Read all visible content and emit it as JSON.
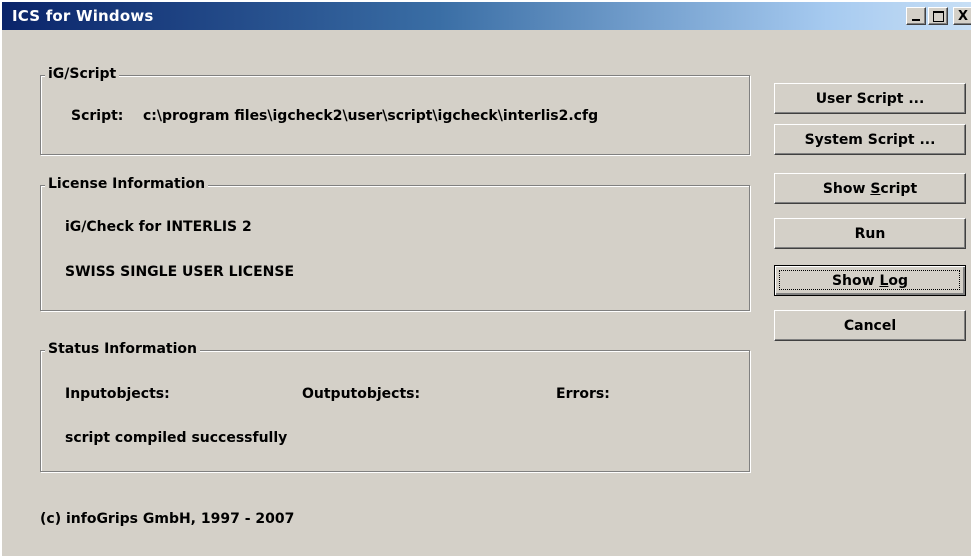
{
  "window": {
    "title": "ICS for Windows"
  },
  "caption_buttons": {
    "close_glyph": "X"
  },
  "script_group": {
    "label": "iG/Script",
    "script_label": "Script:",
    "script_path": "c:\\program files\\igcheck2\\user\\script\\igcheck\\interlis2.cfg"
  },
  "license_group": {
    "label": "License Information",
    "product": "iG/Check for INTERLIS 2",
    "license": "SWISS SINGLE USER LICENSE"
  },
  "status_group": {
    "label": "Status Information",
    "input_label": "Inputobjects:",
    "output_label": "Outputobjects:",
    "errors_label": "Errors:",
    "message": "script compiled successfully"
  },
  "footer": {
    "copyright": "(c) infoGrips GmbH, 1997 - 2007"
  },
  "buttons": {
    "user_script": "User Script ...",
    "system_script": "System Script ...",
    "show_script_prefix": "Show ",
    "show_script_accel": "S",
    "show_script_suffix": "cript",
    "run": "Run",
    "show_log_prefix": "Show ",
    "show_log_accel": "L",
    "show_log_suffix": "og",
    "cancel": "Cancel"
  },
  "colors": {
    "face": "#d4d0c8",
    "title_start": "#0a246a",
    "title_end": "#a6caf0"
  },
  "focused_button": "show_log",
  "icons": {
    "minimize": "minimize-icon",
    "maximize": "maximize-icon",
    "close": "close-icon"
  }
}
